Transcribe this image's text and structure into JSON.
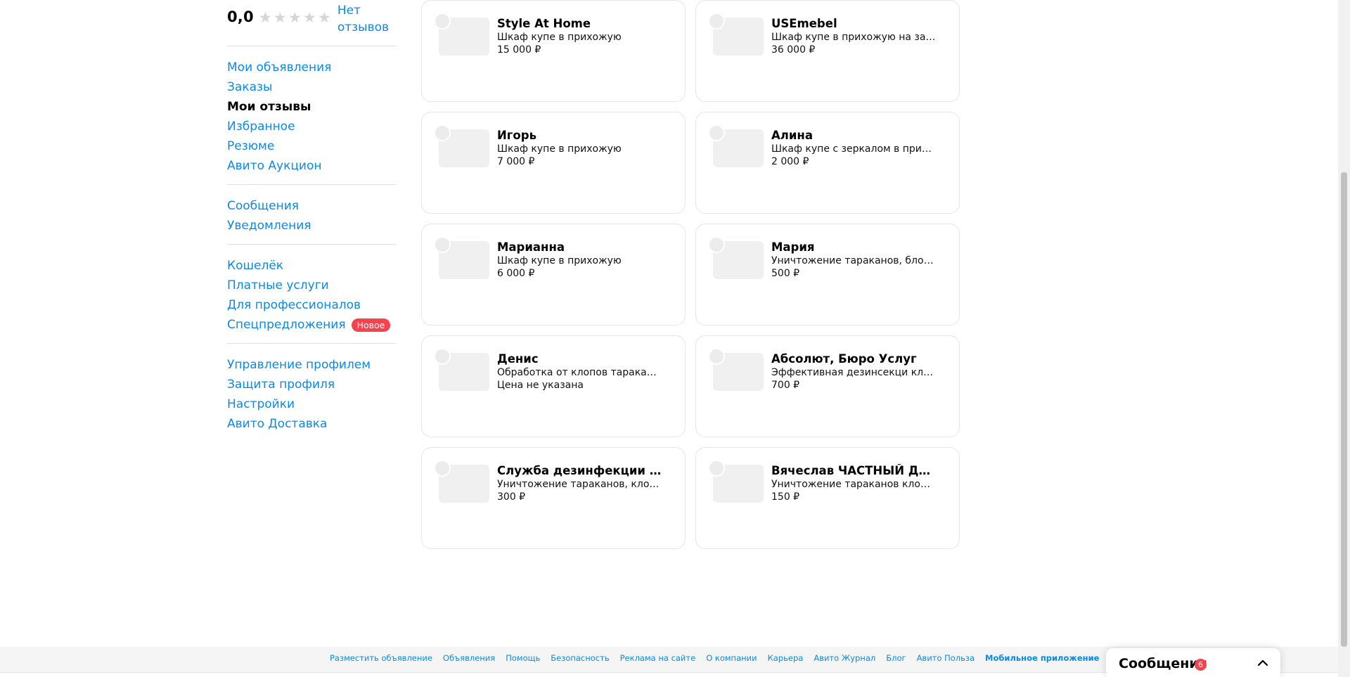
{
  "profile": {
    "rating": "0,0",
    "stars": [
      "★",
      "★",
      "★",
      "★",
      "★"
    ],
    "no_reviews": "Нет отзывов"
  },
  "nav": {
    "group1": [
      "Мои объявления",
      "Заказы",
      "Мои отзывы",
      "Избранное",
      "Резюме",
      "Авито Аукцион"
    ],
    "group2": [
      "Сообщения",
      "Уведомления"
    ],
    "group3": [
      "Кошелёк",
      "Платные услуги",
      "Для профессионалов",
      "Спецпредложения"
    ],
    "new_badge": "Новое",
    "group4": [
      "Управление профилем",
      "Защита профиля",
      "Настройки",
      "Авито Доставка"
    ]
  },
  "reviews": [
    {
      "name": "Style At Home",
      "desc": "Шкаф купе в прихожую",
      "price": "15 000 ₽"
    },
    {
      "name": "USEmebel",
      "desc": "Шкаф купе в прихожую на заказ",
      "price": "36 000 ₽"
    },
    {
      "name": "Игорь",
      "desc": "Шкаф купе в прихожую",
      "price": "7 000 ₽"
    },
    {
      "name": "Алина",
      "desc": "Шкаф купе с зеркалом в прихо...",
      "price": "2 000 ₽"
    },
    {
      "name": "Марианна",
      "desc": "Шкаф купе в прихожую",
      "price": "6 000 ₽"
    },
    {
      "name": "Мария",
      "desc": "Уничтожение тараканов, блох,...",
      "price": "500 ₽"
    },
    {
      "name": "Денис",
      "desc": "Обработка от клопов таракано...",
      "price": "Цена не указана"
    },
    {
      "name": "Абсолют, Бюро Услуг",
      "desc": "Эффективная дезинсекци кло...",
      "price": "700 ₽"
    },
    {
      "name": "Служба дезинфекции Ко...",
      "desc": "Уничтожение тараканов, клоп...",
      "price": "300 ₽"
    },
    {
      "name": "Вячеслав ЧАСТНЫЙ ДЕЗИ...",
      "desc": "Уничтожение тараканов клопо...",
      "price": "150 ₽"
    }
  ],
  "footer": {
    "links": [
      "Разместить объявление",
      "Объявления",
      "Помощь",
      "Безопасность",
      "Реклама на сайте",
      "О компании",
      "Карьера",
      "Авито Журнал",
      "Блог",
      "Авито Польза"
    ],
    "mobile_app": "Мобильное приложение"
  },
  "messages_widget": {
    "title": "Сообщения",
    "count": "6"
  },
  "colors": {
    "link": "#0a8ae6",
    "badge": "#f5424d",
    "star_empty": "#d6d6d6"
  },
  "icons": {
    "star": "star-icon",
    "chevron": "chevron-up-icon",
    "avatar": "avatar-icon",
    "thumb": "listing-thumbnail"
  }
}
